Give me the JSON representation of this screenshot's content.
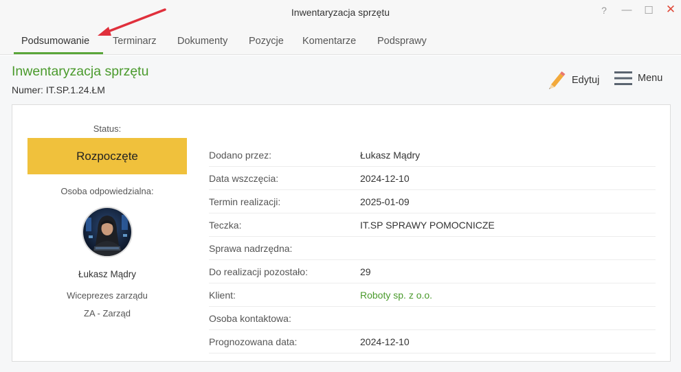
{
  "window": {
    "title": "Inwentaryzacja sprzętu",
    "help_glyph": "?",
    "minimize_glyph": "—",
    "maximize_glyph": "☐",
    "close_glyph": "✕"
  },
  "tabs": [
    {
      "label": "Podsumowanie",
      "active": true
    },
    {
      "label": "Terminarz",
      "active": false
    },
    {
      "label": "Dokumenty",
      "active": false
    },
    {
      "label": "Pozycje",
      "active": false
    },
    {
      "label": "Komentarze",
      "active": false
    },
    {
      "label": "Podsprawy",
      "active": false
    }
  ],
  "header": {
    "title": "Inwentaryzacja sprzętu",
    "number": "Numer: IT.SP.1.24.ŁM",
    "edit_label": "Edytuj",
    "menu_label": "Menu"
  },
  "summary": {
    "status_label": "Status:",
    "status_value": "Rozpoczęte",
    "responsible_label": "Osoba odpowiedzialna:",
    "person_name": "Łukasz Mądry",
    "person_role": "Wiceprezes zarządu",
    "person_department": "ZA - Zarząd"
  },
  "details": [
    {
      "label": "Dodano przez:",
      "value": "Łukasz Mądry"
    },
    {
      "label": "Data wszczęcia:",
      "value": "2024-12-10"
    },
    {
      "label": "Termin realizacji:",
      "value": "2025-01-09"
    },
    {
      "label": "Teczka:",
      "value": "IT.SP SPRAWY POMOCNICZE"
    },
    {
      "label": "Sprawa nadrzędna:",
      "value": ""
    },
    {
      "label": "Do realizacji pozostało:",
      "value": "29"
    },
    {
      "label": "Klient:",
      "value": "Roboty sp. z o.o."
    },
    {
      "label": "Osoba kontaktowa:",
      "value": ""
    },
    {
      "label": "Prognozowana data:",
      "value": "2024-12-10"
    }
  ],
  "colors": {
    "accent_green": "#4a9a2c",
    "status_yellow": "#f0c13c",
    "arrow_red": "#e0303c",
    "close_red": "#e04a3a"
  }
}
